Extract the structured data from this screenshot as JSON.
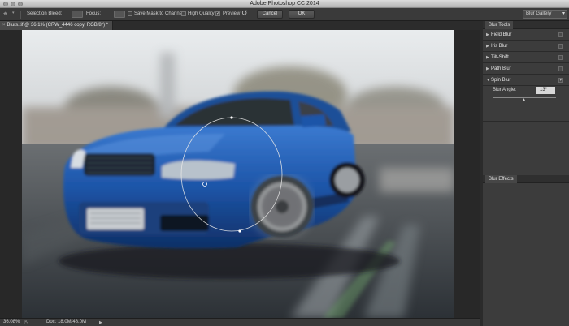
{
  "app": {
    "title": "Adobe Photoshop CC 2014"
  },
  "options": {
    "selection_bleed_label": "Selection Bleed:",
    "focus_label": "Focus:",
    "save_mask_label": "Save Mask to Channels",
    "save_mask_checked": false,
    "high_quality_label": "High Quality",
    "high_quality_checked": false,
    "preview_label": "Preview",
    "preview_checked": true,
    "cancel_label": "Cancel",
    "ok_label": "OK",
    "gallery_label": "Blur Gallery"
  },
  "document": {
    "tab_close": "×",
    "tab_title": "Blurs.tif @ 36.1% (CRW_4446 copy, RGB/8*) *"
  },
  "status": {
    "zoom": "36.08%",
    "doc_size": "Doc: 18.0M/48.0M"
  },
  "blur_tools": {
    "header": "Blur Tools",
    "items": [
      {
        "label": "Field Blur",
        "checked": false
      },
      {
        "label": "Iris Blur",
        "checked": false
      },
      {
        "label": "Tilt-Shift",
        "checked": false
      },
      {
        "label": "Path Blur",
        "checked": false
      },
      {
        "label": "Spin Blur",
        "checked": true
      }
    ],
    "spin": {
      "angle_label": "Blur Angle:",
      "angle_value": "13°",
      "angle_fraction": 0.5
    }
  },
  "blur_effects": {
    "header": "Blur Effects"
  },
  "colors": {
    "car_blue": "#1d55a8",
    "panel_bg": "#3c3c3c",
    "sky": "#dfe2e4",
    "road": "#3d4248"
  }
}
